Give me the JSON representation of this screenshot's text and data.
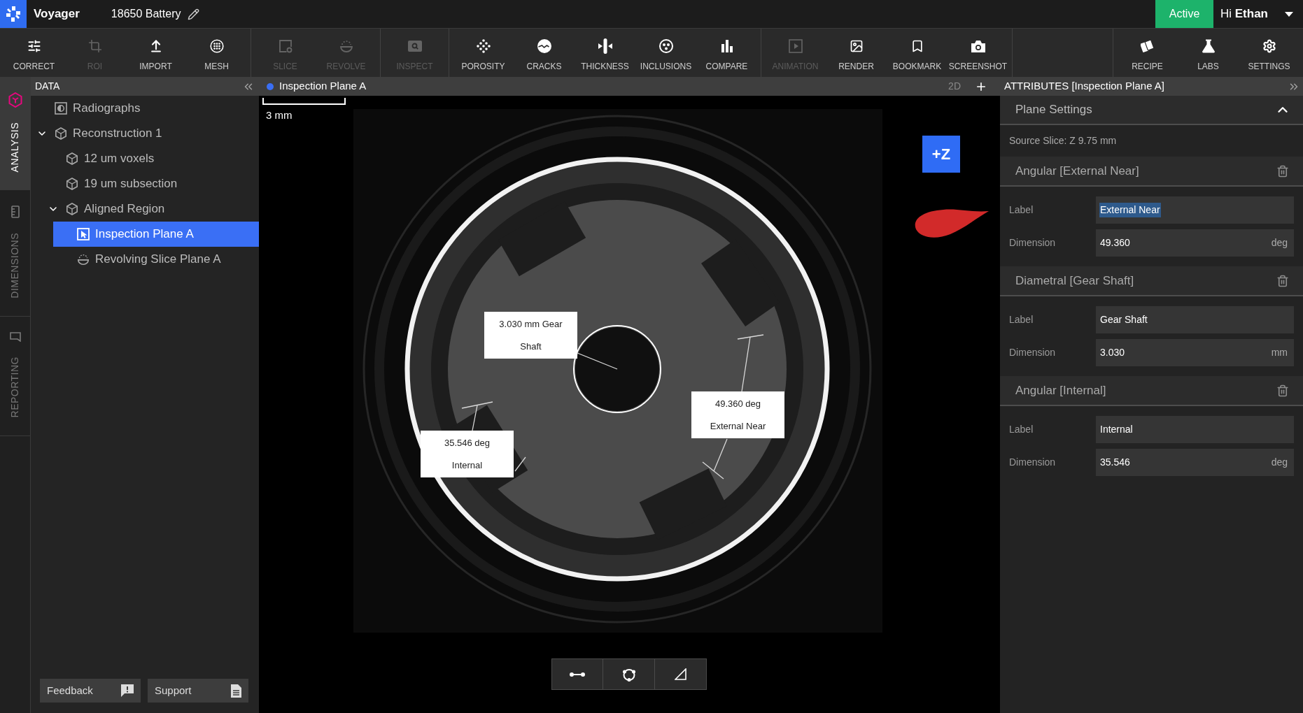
{
  "top_bar": {
    "app_name": "Voyager",
    "project": "18650 Battery",
    "status": "Active",
    "user": "Hi **Ethan**"
  },
  "toolbar": {
    "groups": [
      {
        "items": [
          {
            "label": "CORRECT",
            "disabled": false
          },
          {
            "label": "ROI",
            "disabled": true
          },
          {
            "label": "IMPORT",
            "disabled": false
          },
          {
            "label": "MESH",
            "disabled": false
          }
        ]
      },
      {
        "items": [
          {
            "label": "SLICE",
            "disabled": true
          },
          {
            "label": "REVOLVE",
            "disabled": true
          }
        ]
      },
      {
        "items": [
          {
            "label": "INSPECT",
            "disabled": true
          }
        ]
      },
      {
        "items": [
          {
            "label": "POROSITY",
            "disabled": false
          },
          {
            "label": "CRACKS",
            "disabled": false
          },
          {
            "label": "THICKNESS",
            "disabled": false
          },
          {
            "label": "INCLUSIONS",
            "disabled": false
          },
          {
            "label": "COMPARE",
            "disabled": false
          }
        ]
      },
      {
        "items": [
          {
            "label": "ANIMATION",
            "disabled": true
          },
          {
            "label": "RENDER",
            "disabled": false
          },
          {
            "label": "BOOKMARK",
            "disabled": false
          },
          {
            "label": "SCREENSHOT",
            "disabled": false
          }
        ]
      }
    ],
    "right_items": [
      {
        "label": "RECIPE",
        "disabled": false
      },
      {
        "label": "LABS",
        "disabled": false
      },
      {
        "label": "SETTINGS",
        "disabled": false
      }
    ]
  },
  "side_tabs": [
    {
      "label": "ANALYSIS",
      "selected": true
    },
    {
      "label": "DIMENSIONS",
      "selected": false
    },
    {
      "label": "REPORTING",
      "selected": false
    }
  ],
  "data_panel": {
    "title": "DATA",
    "tree": [
      {
        "kind": "radiographs",
        "label": "Radiographs",
        "selected": false
      },
      {
        "kind": "volume",
        "label": "Reconstruction 1",
        "selected": false,
        "expanded": true,
        "children": [
          {
            "kind": "volume",
            "label": "12 um voxels",
            "selected": false
          },
          {
            "kind": "volume",
            "label": "19 um subsection",
            "selected": false
          },
          {
            "kind": "volume",
            "label": "Aligned Region",
            "selected": false,
            "expanded": true,
            "children": [
              {
                "kind": "plane",
                "label": "Inspection Plane A",
                "selected": true
              },
              {
                "kind": "revolving_slice",
                "label": "Revolving Slice Plane A",
                "selected": false
              }
            ]
          }
        ]
      }
    ],
    "footer_buttons": [
      {
        "label": "Feedback"
      },
      {
        "label": "Support"
      }
    ]
  },
  "viewport": {
    "title": "Inspection Plane A",
    "view_mode": "2D",
    "scale_bar": "3 mm",
    "axis_button": "+Z",
    "annotations": [
      {
        "kind": "diametral",
        "text": "3.030 mm Gear Shaft"
      },
      {
        "kind": "angular",
        "text": "49.360 deg External Near"
      },
      {
        "kind": "angular",
        "text": "35.546 deg Internal"
      }
    ]
  },
  "attributes": {
    "title": "ATTRIBUTES [Inspection Plane A]",
    "plane_settings": {
      "title": "Plane Settings",
      "expanded": true,
      "source": "Source Slice: Z 9.75 mm"
    },
    "measurements": [
      {
        "title": "Angular [External Near]",
        "fields": [
          {
            "label": "Label",
            "value": "External Near",
            "text_highlighted": true
          },
          {
            "label": "Dimension",
            "value": "49.360",
            "unit": "deg",
            "text_highlighted": false
          }
        ]
      },
      {
        "title": "Diametral [Gear Shaft]",
        "fields": [
          {
            "label": "Label",
            "value": "Gear Shaft",
            "text_highlighted": false
          },
          {
            "label": "Dimension",
            "value": "3.030",
            "unit": "mm",
            "text_highlighted": false
          }
        ]
      },
      {
        "title": "Angular [Internal]",
        "fields": [
          {
            "label": "Label",
            "value": "Internal",
            "text_highlighted": false
          },
          {
            "label": "Dimension",
            "value": "35.546",
            "unit": "deg",
            "text_highlighted": false
          }
        ]
      }
    ]
  }
}
